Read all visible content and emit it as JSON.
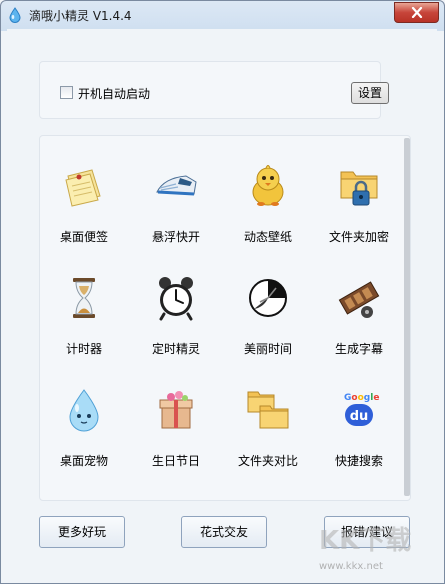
{
  "window": {
    "title": "滴哦小精灵 V1.4.4"
  },
  "settings_panel": {
    "autostart_label": "开机自动启动",
    "autostart_checked": false,
    "settings_button": "设置"
  },
  "tools": [
    {
      "label": "桌面便签",
      "icon": "sticky-note-icon"
    },
    {
      "label": "悬浮快开",
      "icon": "bullet-train-icon"
    },
    {
      "label": "动态壁纸",
      "icon": "chick-icon"
    },
    {
      "label": "文件夹加密",
      "icon": "folder-lock-icon"
    },
    {
      "label": "计时器",
      "icon": "hourglass-icon"
    },
    {
      "label": "定时精灵",
      "icon": "alarm-clock-icon"
    },
    {
      "label": "美丽时间",
      "icon": "clock-face-icon"
    },
    {
      "label": "生成字幕",
      "icon": "film-strip-icon"
    },
    {
      "label": "桌面宠物",
      "icon": "water-drop-pet-icon"
    },
    {
      "label": "生日节日",
      "icon": "gift-box-icon"
    },
    {
      "label": "文件夹对比",
      "icon": "folder-compare-icon"
    },
    {
      "label": "快捷搜索",
      "icon": "baidu-search-icon"
    }
  ],
  "footer": {
    "more_fun": "更多好玩",
    "fancy_friends": "花式交友",
    "report_suggest": "报错/建议"
  },
  "watermark": {
    "text": "KK下载",
    "url": "www.kkx.net"
  }
}
